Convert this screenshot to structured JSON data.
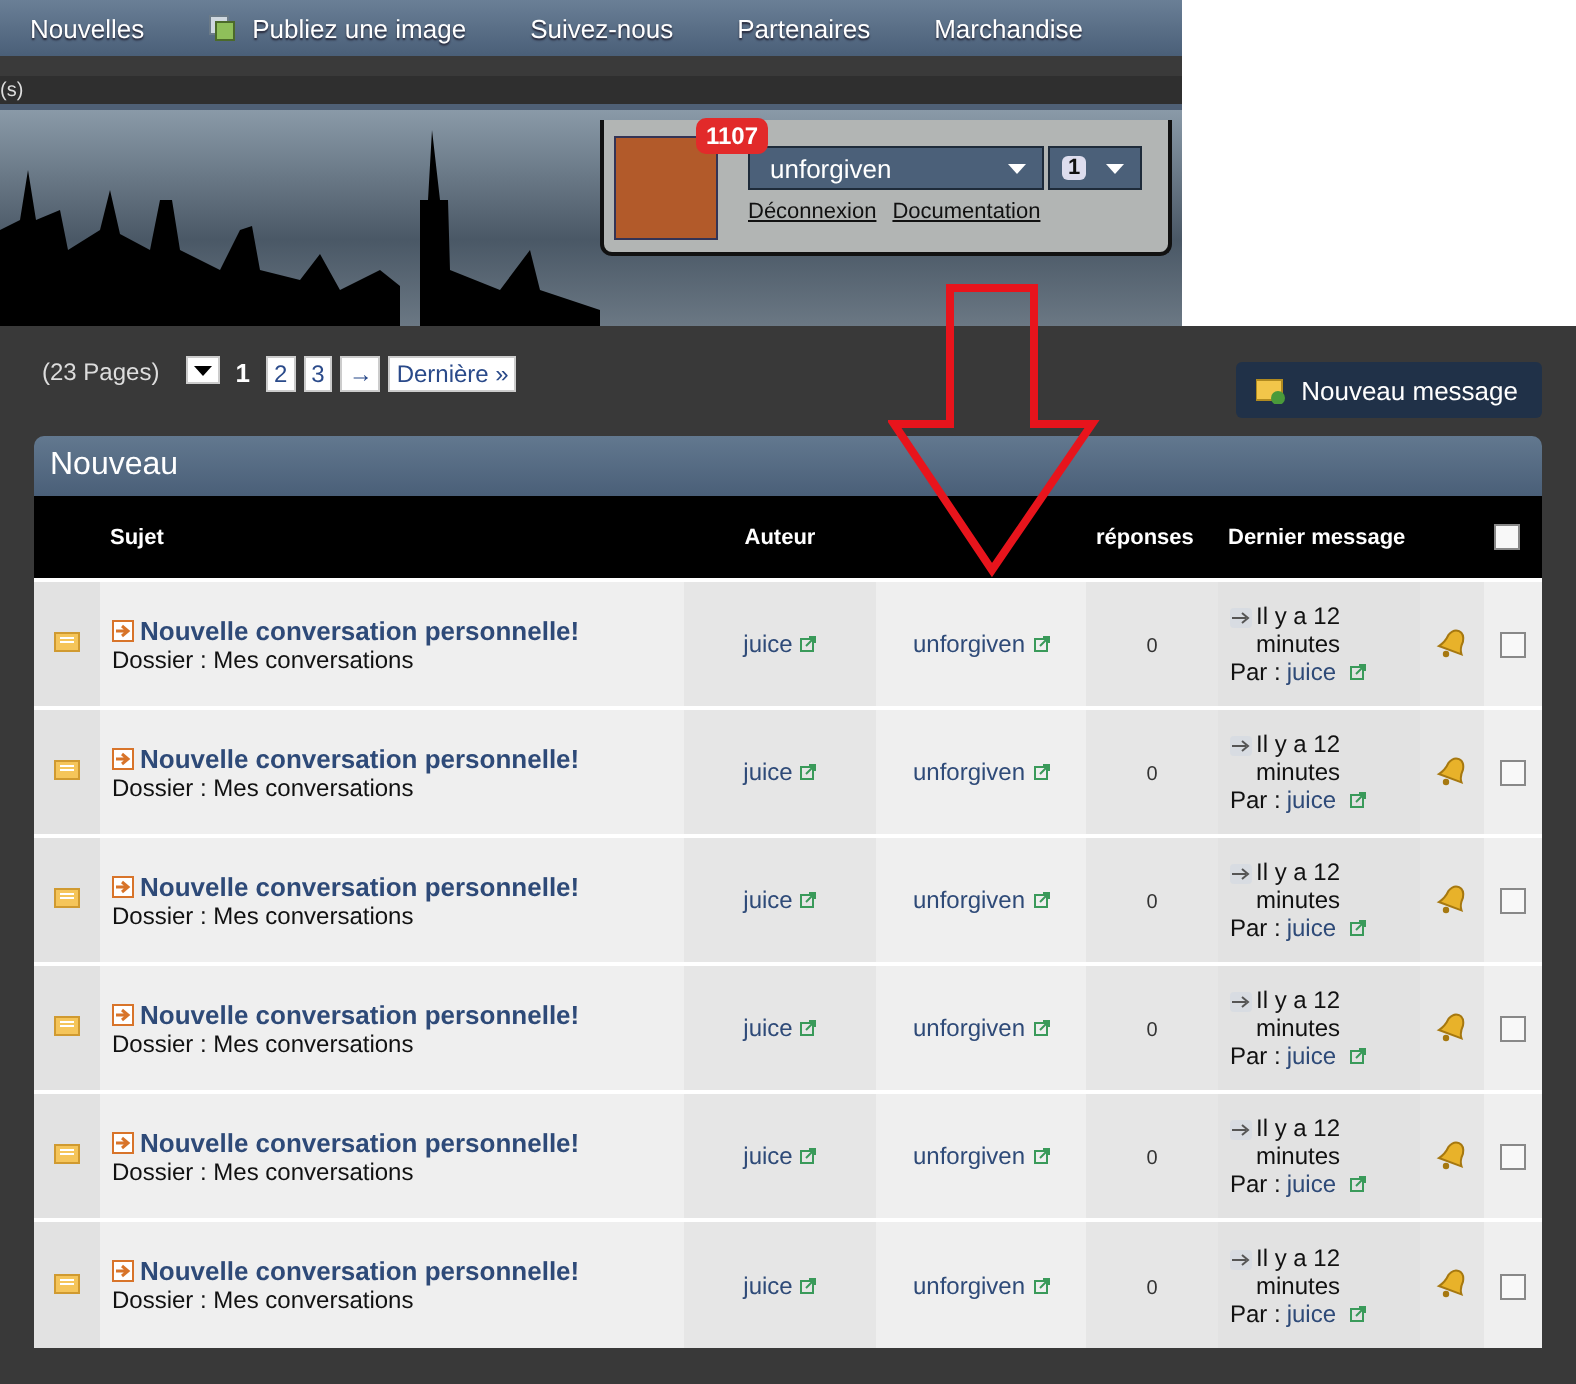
{
  "nav": [
    {
      "label": "Nouvelles",
      "icon": false
    },
    {
      "label": "Publiez une image",
      "icon": true
    },
    {
      "label": "Suivez-nous",
      "icon": false
    },
    {
      "label": "Partenaires",
      "icon": false
    },
    {
      "label": "Marchandise",
      "icon": false
    }
  ],
  "substrip": "(s)",
  "user_panel": {
    "badge": "1107",
    "username": "unforgiven",
    "count": "1",
    "links": [
      "Déconnexion",
      "Documentation"
    ]
  },
  "pagination": {
    "label": "(23 Pages)",
    "pages": [
      {
        "label": "1",
        "selected": true
      },
      {
        "label": "2",
        "selected": false
      },
      {
        "label": "3",
        "selected": false
      }
    ],
    "next": "→",
    "last": "Dernière »"
  },
  "new_button": "Nouveau message",
  "table": {
    "title": "Nouveau",
    "columns": {
      "subject": "Sujet",
      "author": "Auteur",
      "replies": "réponses",
      "last": "Dernier message"
    },
    "select_all_checked": false,
    "rows": [
      {
        "title": "Nouvelle conversation personnelle!",
        "folder": "Dossier : Mes conversations",
        "author": "juice",
        "recipient": "unforgiven",
        "replies": "0",
        "last_time": "Il y a 12 minutes",
        "by_label": "Par :",
        "by": "juice",
        "checked": false
      },
      {
        "title": "Nouvelle conversation personnelle!",
        "folder": "Dossier : Mes conversations",
        "author": "juice",
        "recipient": "unforgiven",
        "replies": "0",
        "last_time": "Il y a 12 minutes",
        "by_label": "Par :",
        "by": "juice",
        "checked": false
      },
      {
        "title": "Nouvelle conversation personnelle!",
        "folder": "Dossier : Mes conversations",
        "author": "juice",
        "recipient": "unforgiven",
        "replies": "0",
        "last_time": "Il y a 12 minutes",
        "by_label": "Par :",
        "by": "juice",
        "checked": false
      },
      {
        "title": "Nouvelle conversation personnelle!",
        "folder": "Dossier : Mes conversations",
        "author": "juice",
        "recipient": "unforgiven",
        "replies": "0",
        "last_time": "Il y a 12 minutes",
        "by_label": "Par :",
        "by": "juice",
        "checked": false
      },
      {
        "title": "Nouvelle conversation personnelle!",
        "folder": "Dossier : Mes conversations",
        "author": "juice",
        "recipient": "unforgiven",
        "replies": "0",
        "last_time": "Il y a 12 minutes",
        "by_label": "Par :",
        "by": "juice",
        "checked": false
      },
      {
        "title": "Nouvelle conversation personnelle!",
        "folder": "Dossier : Mes conversations",
        "author": "juice",
        "recipient": "unforgiven",
        "replies": "0",
        "last_time": "Il y a 12 minutes",
        "by_label": "Par :",
        "by": "juice",
        "checked": false
      }
    ]
  }
}
